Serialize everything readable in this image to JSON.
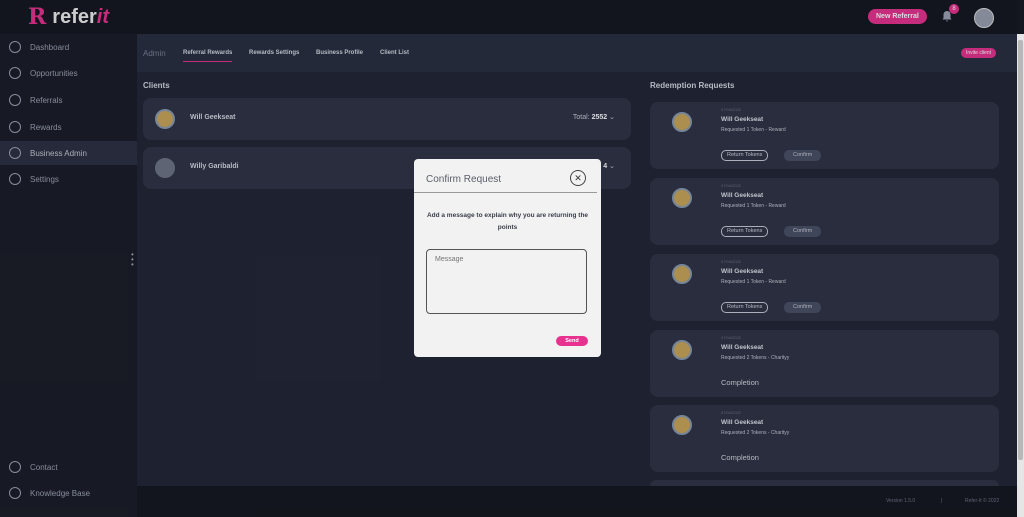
{
  "brand": {
    "mark": "R",
    "name_a": "refer",
    "name_b": "it",
    "color": "#e8328f"
  },
  "header": {
    "new_referral": "New Referral",
    "notifications": "8"
  },
  "sidebar": {
    "items": [
      {
        "label": "Dashboard",
        "icon": "dashboard-icon"
      },
      {
        "label": "Opportunities",
        "icon": "lightbulb-icon"
      },
      {
        "label": "Referrals",
        "icon": "referrals-icon"
      },
      {
        "label": "Rewards",
        "icon": "award-icon"
      },
      {
        "label": "Business Admin",
        "icon": "business-icon"
      },
      {
        "label": "Settings",
        "icon": "gear-icon"
      }
    ],
    "bottom": [
      {
        "label": "Contact",
        "icon": "help-icon"
      },
      {
        "label": "Knowledge Base",
        "icon": "info-icon"
      }
    ]
  },
  "tabs": {
    "admin": "Admin",
    "items": [
      "Referral Rewards",
      "Rewards Settings",
      "Business Profile",
      "Client List"
    ],
    "invite": "Invite client"
  },
  "clients": {
    "title": "Clients",
    "rows": [
      {
        "name": "Will Geekseat",
        "total_label": "Total:",
        "total": "2552"
      },
      {
        "name": "Willy Garibaldi",
        "total_label": "",
        "total": "4"
      }
    ]
  },
  "redemptions": {
    "title": "Redemption Requests",
    "return_label": "Return Tokens",
    "confirm_label": "Confirm",
    "items": [
      {
        "date": "07/04/2022",
        "name": "Will Geekseat",
        "desc": "Requested 1 Token - Reward",
        "status": ""
      },
      {
        "date": "07/04/2022",
        "name": "Will Geekseat",
        "desc": "Requested 1 Token - Reward",
        "status": ""
      },
      {
        "date": "07/04/2022",
        "name": "Will Geekseat",
        "desc": "Requested 1 Token - Reward",
        "status": ""
      },
      {
        "date": "07/04/2022",
        "name": "Will Geekseat",
        "desc": "Requested 2 Tokens - Charityy",
        "status": "Completion"
      },
      {
        "date": "07/04/2022",
        "name": "Will Geekseat",
        "desc": "Requested 2 Tokens - Charityy",
        "status": "Completion"
      }
    ]
  },
  "footer": {
    "version": "Version 1.5.0",
    "sep": "|",
    "copyright": "Refer-It © 2022"
  },
  "modal": {
    "title": "Confirm Request",
    "message": "Add a message to explain why you are returning the points",
    "placeholder": "Message",
    "send": "Send"
  }
}
